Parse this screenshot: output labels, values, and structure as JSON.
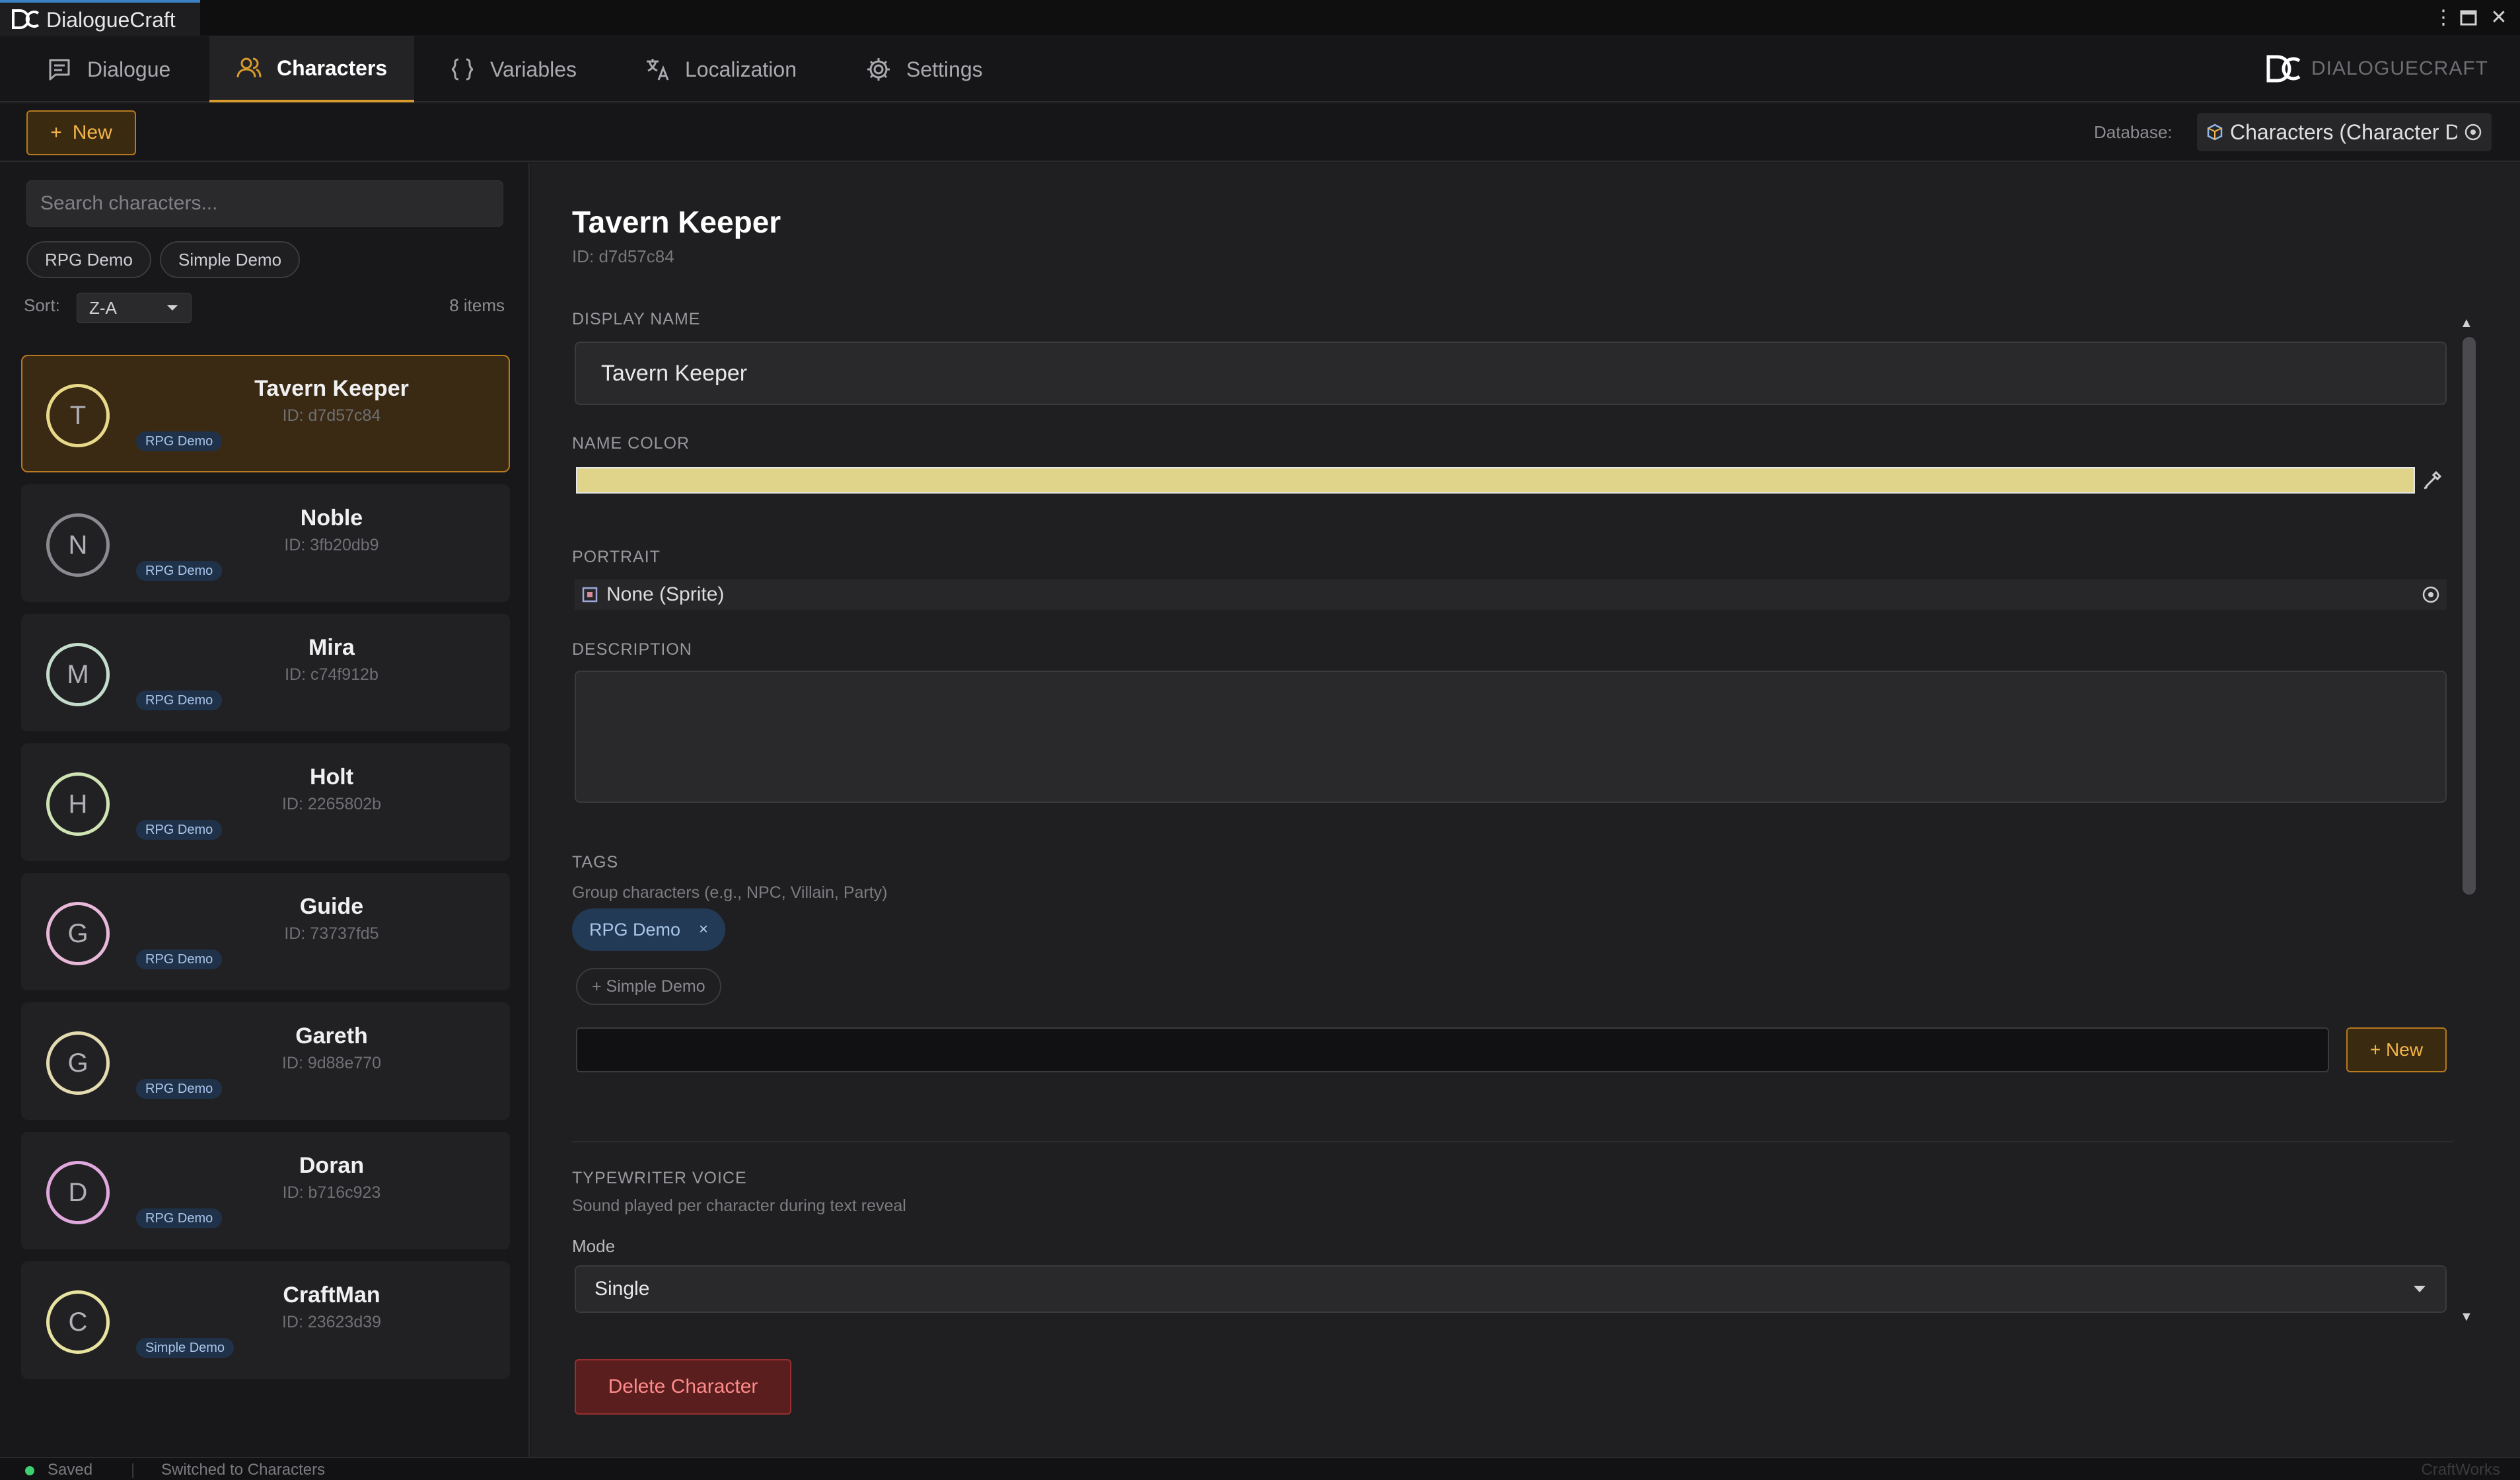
{
  "window": {
    "title": "DialogueCraft"
  },
  "nav": {
    "tabs": [
      {
        "label": "Dialogue",
        "icon": "message-square-icon"
      },
      {
        "label": "Characters",
        "icon": "users-icon",
        "active": true
      },
      {
        "label": "Variables",
        "icon": "braces-icon"
      },
      {
        "label": "Localization",
        "icon": "translate-icon"
      },
      {
        "label": "Settings",
        "icon": "gear-icon"
      }
    ],
    "brand": "DIALOGUECRAFT"
  },
  "toolbar": {
    "new_label": "New",
    "database_label": "Database:",
    "database_value": "Characters (Character Database)"
  },
  "sidebar": {
    "search_placeholder": "Search characters...",
    "filters": [
      "RPG Demo",
      "Simple Demo"
    ],
    "sort_label": "Sort:",
    "sort_value": "Z-A",
    "item_count": "8 items",
    "characters": [
      {
        "initial": "T",
        "name": "Tavern Keeper",
        "id": "ID: d7d57c84",
        "tag": "RPG Demo",
        "ring": "#e8d98a",
        "selected": true
      },
      {
        "initial": "N",
        "name": "Noble",
        "id": "ID: 3fb20db9",
        "tag": "RPG Demo",
        "ring": "#8a8a90"
      },
      {
        "initial": "M",
        "name": "Mira",
        "id": "ID: c74f912b",
        "tag": "RPG Demo",
        "ring": "#c4dccb"
      },
      {
        "initial": "H",
        "name": "Holt",
        "id": "ID: 2265802b",
        "tag": "RPG Demo",
        "ring": "#cfe3b4"
      },
      {
        "initial": "G",
        "name": "Guide",
        "id": "ID: 73737fd5",
        "tag": "RPG Demo",
        "ring": "#e8b8d8"
      },
      {
        "initial": "G",
        "name": "Gareth",
        "id": "ID: 9d88e770",
        "tag": "RPG Demo",
        "ring": "#e4dcb0"
      },
      {
        "initial": "D",
        "name": "Doran",
        "id": "ID: b716c923",
        "tag": "RPG Demo",
        "ring": "#e0a8dc"
      },
      {
        "initial": "C",
        "name": "CraftMan",
        "id": "ID: 23623d39",
        "tag": "Simple Demo",
        "ring": "#e8e4a0"
      }
    ]
  },
  "editor": {
    "title": "Tavern Keeper",
    "id": "ID: d7d57c84",
    "display_name_label": "DISPLAY NAME",
    "display_name_value": "Tavern Keeper",
    "name_color_label": "NAME COLOR",
    "name_color": "#e0d48a",
    "portrait_label": "PORTRAIT",
    "portrait_value": "None (Sprite)",
    "description_label": "DESCRIPTION",
    "description_value": "",
    "tags_label": "TAGS",
    "tags_help": "Group characters (e.g., NPC, Villain, Party)",
    "tags": [
      "RPG Demo"
    ],
    "tag_remove_glyph": "×",
    "available_tag": "+ Simple Demo",
    "tag_input_value": "",
    "tag_new_label": "+ New",
    "voice_label": "TYPEWRITER VOICE",
    "voice_help": "Sound played per character during text reveal",
    "mode_label": "Mode",
    "mode_value": "Single",
    "delete_label": "Delete Character"
  },
  "status": {
    "saved": "Saved",
    "message": "Switched to Characters",
    "brand": "CraftWorks"
  },
  "colors": {
    "accent": "#d99b2b",
    "danger": "#9b2f2f",
    "tag": "#233a56"
  }
}
